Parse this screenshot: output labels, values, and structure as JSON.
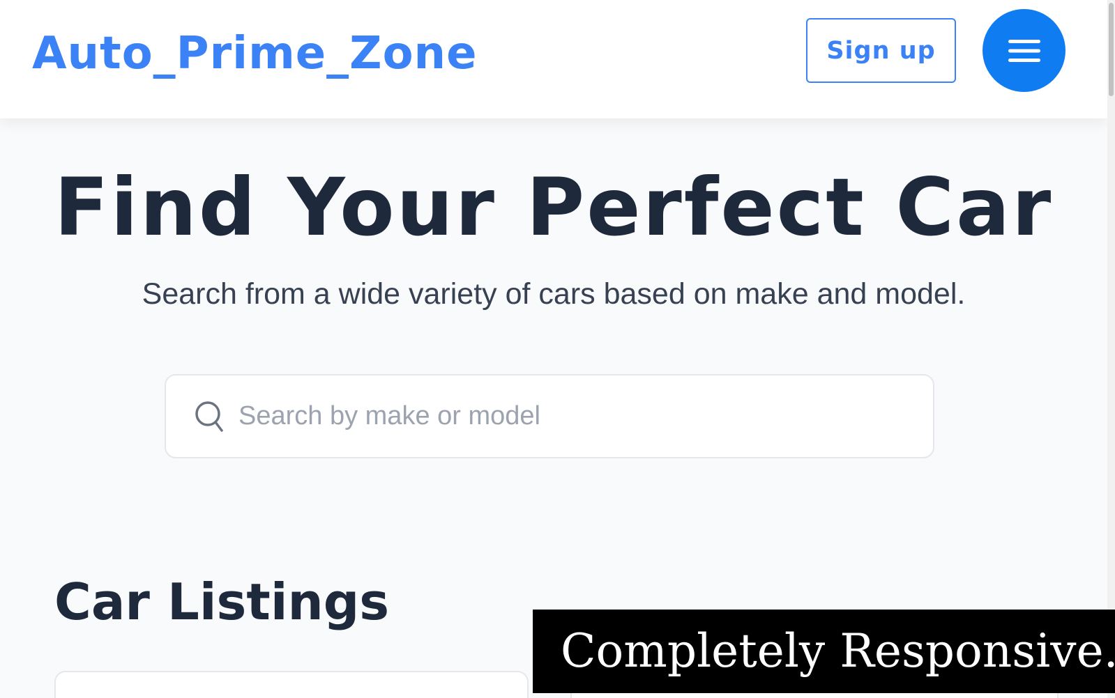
{
  "header": {
    "brand": "Auto_Prime_Zone",
    "signup_label": "Sign up",
    "menu_icon": "hamburger-menu-icon"
  },
  "hero": {
    "title": "Find Your Perfect Car",
    "subtitle": "Search from a wide variety of cars based on make and model."
  },
  "search": {
    "icon": "search-icon",
    "placeholder": "Search by make or model",
    "value": ""
  },
  "listings": {
    "title": "Car Listings"
  },
  "banner": {
    "text": "Completely Responsive."
  },
  "colors": {
    "brand": "#3b82f6",
    "menu_button": "#0f7cf2",
    "heading": "#1e293b",
    "background": "#f9fafb"
  }
}
